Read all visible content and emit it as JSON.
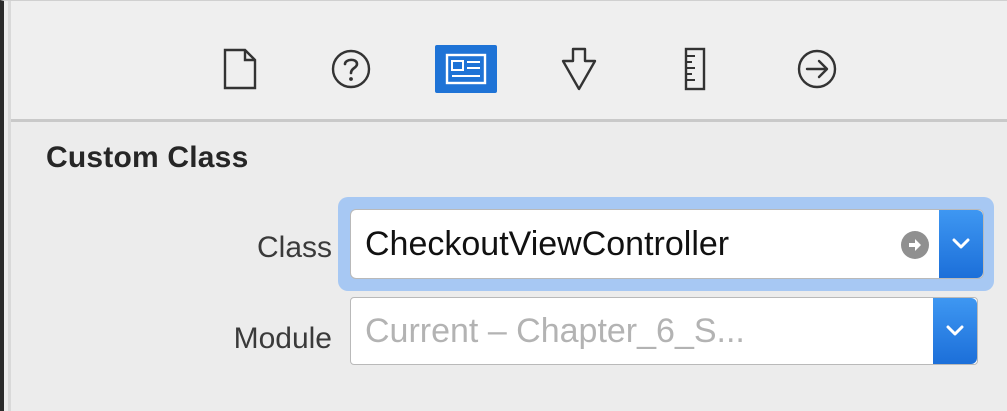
{
  "toolbar": {
    "icons": [
      {
        "name": "file-icon",
        "selected": false
      },
      {
        "name": "help-icon",
        "selected": false
      },
      {
        "name": "identity-icon",
        "selected": true
      },
      {
        "name": "attributes-icon",
        "selected": false
      },
      {
        "name": "size-icon",
        "selected": false
      },
      {
        "name": "connections-icon",
        "selected": false
      }
    ]
  },
  "section": {
    "title": "Custom Class"
  },
  "class_field": {
    "label": "Class",
    "value": "CheckoutViewController"
  },
  "module_field": {
    "label": "Module",
    "placeholder": "Current – Chapter_6_S..."
  },
  "colors": {
    "accent": "#1e73d6",
    "focus_ring": "#a7c8f3",
    "placeholder_text": "#b3b3b3",
    "value_text": "#111111"
  }
}
